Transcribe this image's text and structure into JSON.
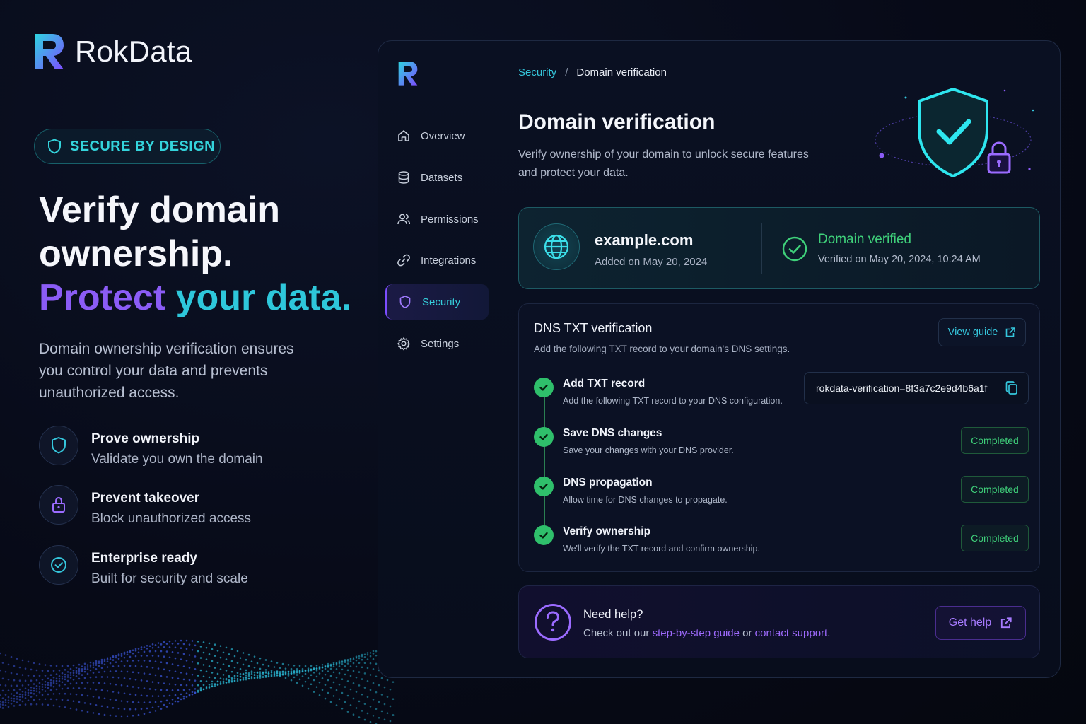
{
  "brand": {
    "name": "RokData",
    "logo_icon": "rokdata-r-logo-icon"
  },
  "hero": {
    "badge": "SECURE BY DESIGN",
    "title_line1": "Verify domain",
    "title_line2": "ownership.",
    "title_highlight1": "Protect",
    "title_highlight2": "your data.",
    "description": "Domain ownership verification ensures you control your data and prevents unauthorized access.",
    "features": [
      {
        "icon": "shield-icon",
        "title": "Prove ownership",
        "subtitle": "Validate you own the domain"
      },
      {
        "icon": "lock-icon",
        "title": "Prevent takeover",
        "subtitle": "Block unauthorized access"
      },
      {
        "icon": "check-circle-icon",
        "title": "Enterprise ready",
        "subtitle": "Built for security and scale"
      }
    ]
  },
  "sidebar": {
    "items": [
      {
        "label": "Overview",
        "icon": "home-icon",
        "active": false
      },
      {
        "label": "Datasets",
        "icon": "database-icon",
        "active": false
      },
      {
        "label": "Permissions",
        "icon": "users-icon",
        "active": false
      },
      {
        "label": "Integrations",
        "icon": "link-icon",
        "active": false
      },
      {
        "label": "Security",
        "icon": "shield-icon",
        "active": true
      },
      {
        "label": "Settings",
        "icon": "gear-icon",
        "active": false
      }
    ]
  },
  "breadcrumb": {
    "parent": "Security",
    "separator": "/",
    "current": "Domain verification"
  },
  "page": {
    "title": "Domain verification",
    "description": "Verify ownership of your domain to unlock secure features and protect your data."
  },
  "domain": {
    "name": "example.com",
    "added": "Added on May 20, 2024",
    "status": "Domain verified",
    "verified_on": "Verified on May 20, 2024, 10:24 AM"
  },
  "dns": {
    "title": "DNS TXT verification",
    "subtitle": "Add the following TXT record to your domain's DNS settings.",
    "guide_button": "View guide",
    "steps": [
      {
        "title": "Add TXT record",
        "description": "Add the following TXT record to your DNS configuration.",
        "value": "rokdata-verification=8f3a7c2e9d4b6a1f"
      },
      {
        "title": "Save DNS changes",
        "description": "Save your changes with your DNS provider.",
        "status": "Completed"
      },
      {
        "title": "DNS propagation",
        "description": "Allow time for DNS changes to propagate.",
        "status": "Completed"
      },
      {
        "title": "Verify ownership",
        "description": "We'll verify the TXT record and confirm ownership.",
        "status": "Completed"
      }
    ]
  },
  "help": {
    "title": "Need help?",
    "text_prefix": "Check out our ",
    "link1": "step-by-step guide",
    "text_middle": " or ",
    "link2": "contact support",
    "text_suffix": ".",
    "button": "Get help"
  },
  "colors": {
    "accent_cyan": "#2ec7db",
    "accent_purple": "#8b5cf6",
    "success_green": "#3fd07a",
    "background": "#070a17"
  }
}
